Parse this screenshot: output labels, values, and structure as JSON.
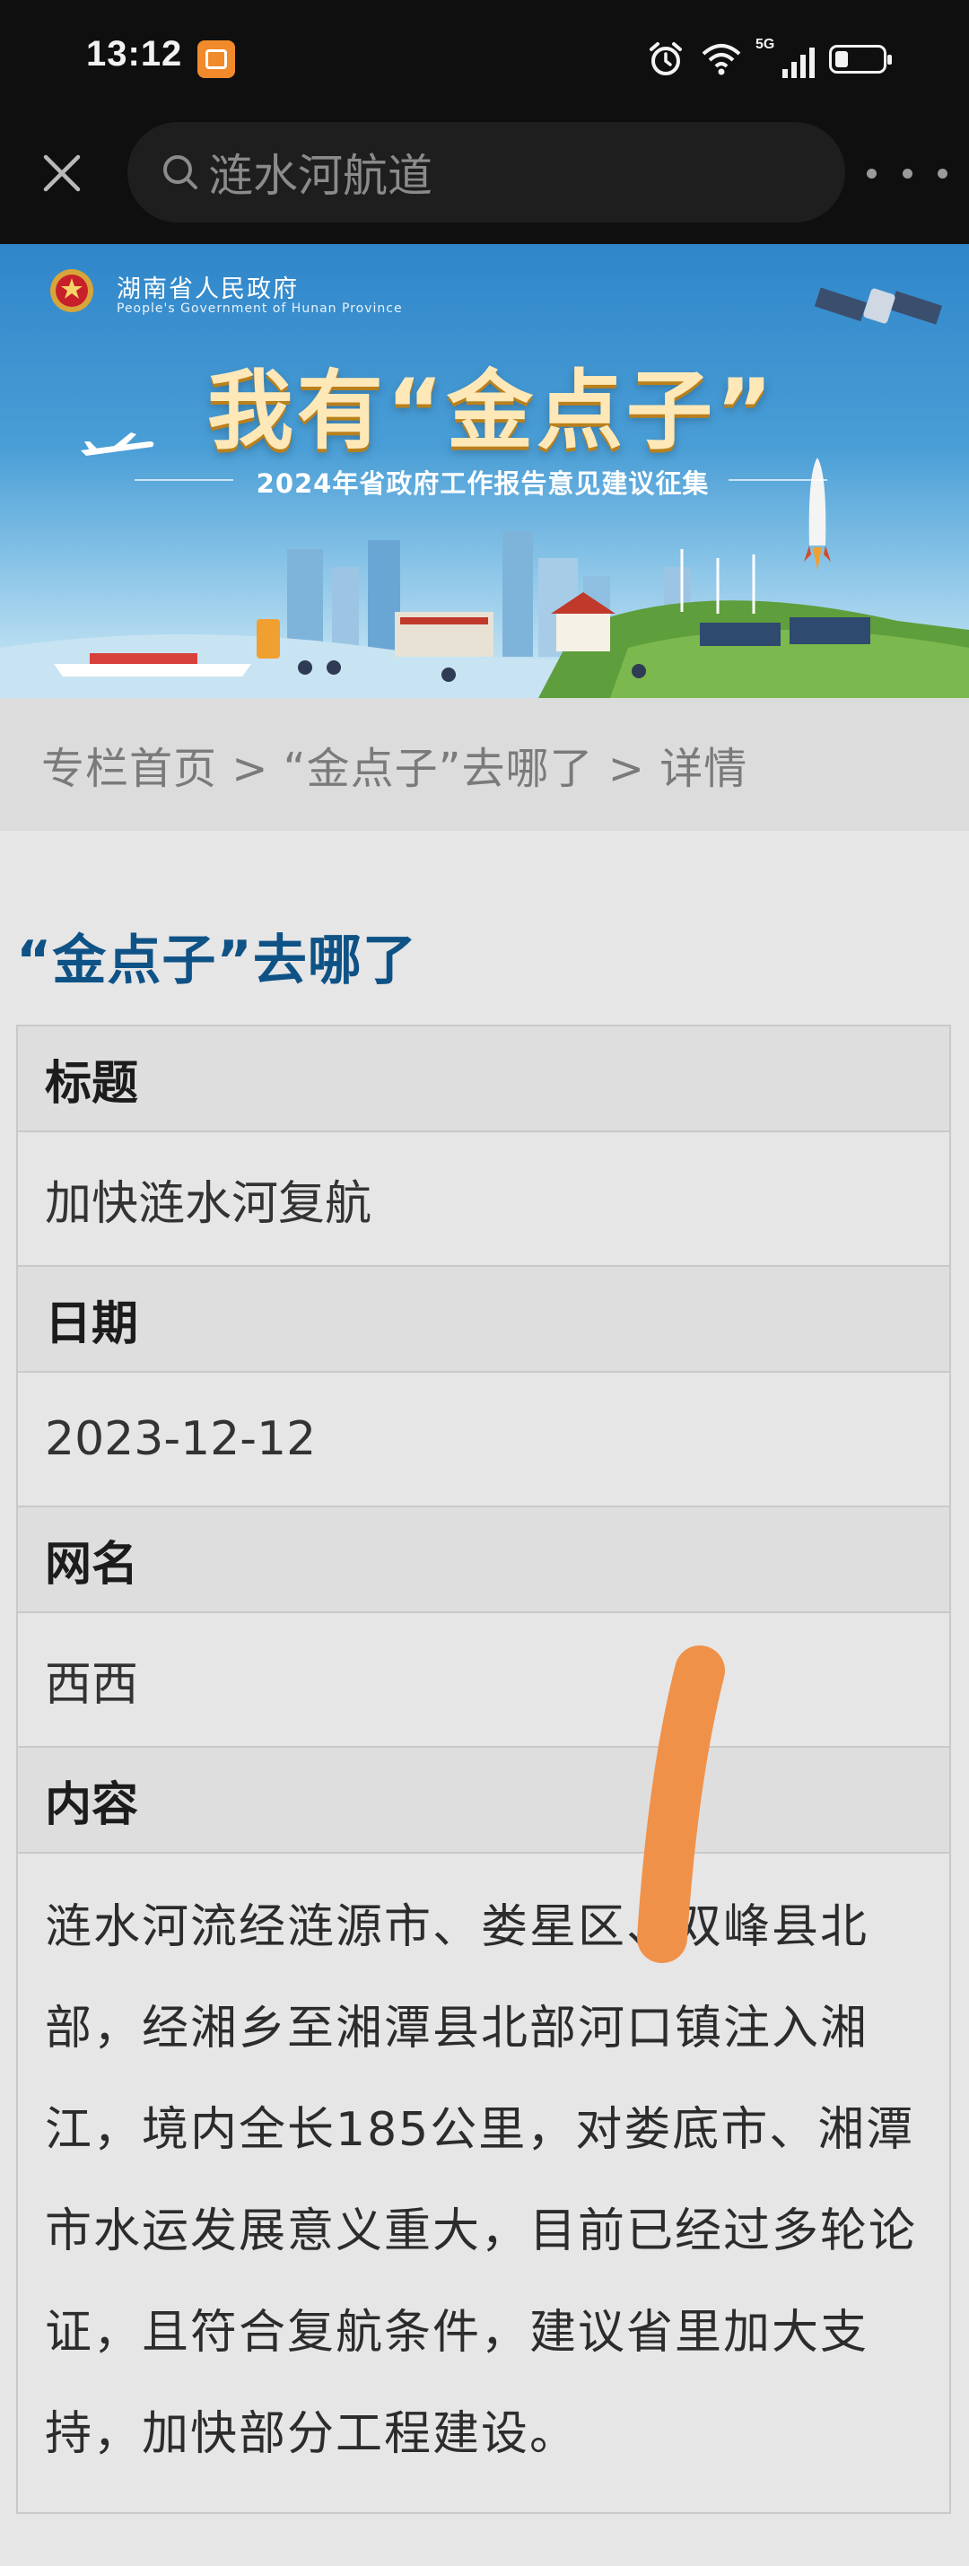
{
  "status_bar": {
    "time": "13:12",
    "network": "5G",
    "icons": [
      "app-notification-icon",
      "alarm-icon",
      "wifi-icon",
      "signal-icon",
      "battery-icon"
    ]
  },
  "nav": {
    "search_text": "涟水河航道"
  },
  "banner": {
    "gov_title": "湖南省人民政府",
    "gov_subtitle": "People's Government of Hunan Province",
    "headline": "我有“金点子”",
    "subtitle": "2024年省政府工作报告意见建议征集"
  },
  "breadcrumb": {
    "text": "专栏首页 > “金点子”去哪了 > 详情"
  },
  "section_title": "“金点子”去哪了",
  "detail": {
    "title_label": "标题",
    "title_value": "加快涟水河复航",
    "date_label": "日期",
    "date_value": "2023-12-12",
    "name_label": "网名",
    "name_value": "西西",
    "content_label": "内容",
    "content_value": "涟水河流经涟源市、娄星区、双峰县北部，经湘乡至湘潭县北部河口镇注入湘江，境内全长185公里，对娄底市、湘潭市水运发展意义重大，目前已经过多轮论证，且符合复航条件，建议省里加大支持，加快部分工程建设。"
  },
  "colors": {
    "title_blue": "#0e5286",
    "scribble_orange": "#f0914a",
    "banner_blue": "#2f86c9",
    "banner_gold": "#ffe8b8"
  }
}
